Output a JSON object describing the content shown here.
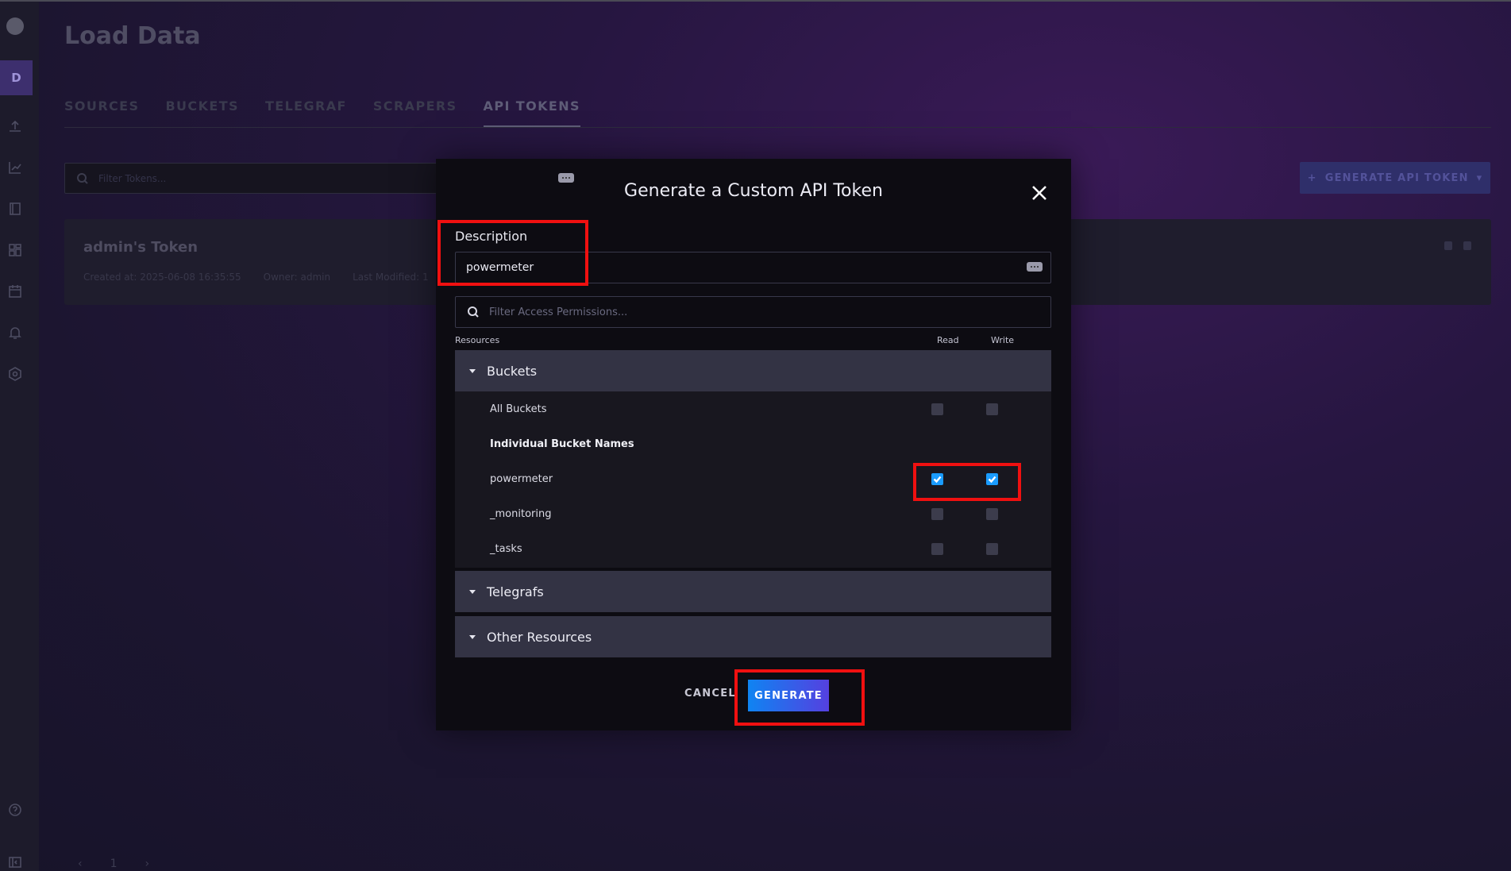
{
  "page": {
    "title": "Load Data",
    "tabs": [
      "SOURCES",
      "BUCKETS",
      "TELEGRAF",
      "SCRAPERS",
      "API TOKENS"
    ],
    "active_tab": "API TOKENS",
    "filter_placeholder": "Filter Tokens...",
    "generate_button": "GENERATE API TOKEN",
    "token_card": {
      "name": "admin's Token",
      "created": "Created at: 2025-06-08 16:35:55",
      "owner": "Owner: admin",
      "modified": "Last Modified: 1"
    },
    "pagination": {
      "prev": "‹",
      "page": "1",
      "next": "›"
    }
  },
  "sidebar": {
    "org_initial": "D",
    "icons": [
      "upload-icon",
      "graph-icon",
      "notebook-icon",
      "dashboard-icon",
      "calendar-icon",
      "bell-icon",
      "settings-icon",
      "help-icon",
      "collapse-icon"
    ]
  },
  "modal": {
    "title": "Generate a Custom API Token",
    "description_label": "Description",
    "description_value": "powermeter",
    "permission_filter_placeholder": "Filter Access Permissions...",
    "columns": {
      "resources": "Resources",
      "read": "Read",
      "write": "Write"
    },
    "sections": {
      "buckets": {
        "label": "Buckets",
        "all_label": "All Buckets",
        "individual_heading": "Individual Bucket Names",
        "items": [
          {
            "name": "powermeter",
            "read": true,
            "write": true
          },
          {
            "name": "_monitoring",
            "read": false,
            "write": false
          },
          {
            "name": "_tasks",
            "read": false,
            "write": false
          }
        ]
      },
      "telegrafs": {
        "label": "Telegrafs"
      },
      "other": {
        "label": "Other Resources"
      }
    },
    "cancel_label": "CANCEL",
    "generate_label": "GENERATE"
  },
  "colors": {
    "accent_gradient_start": "#0f84f2",
    "accent_gradient_end": "#5540e0",
    "checkbox_on": "#1a9cff",
    "annotation": "#f01010"
  }
}
